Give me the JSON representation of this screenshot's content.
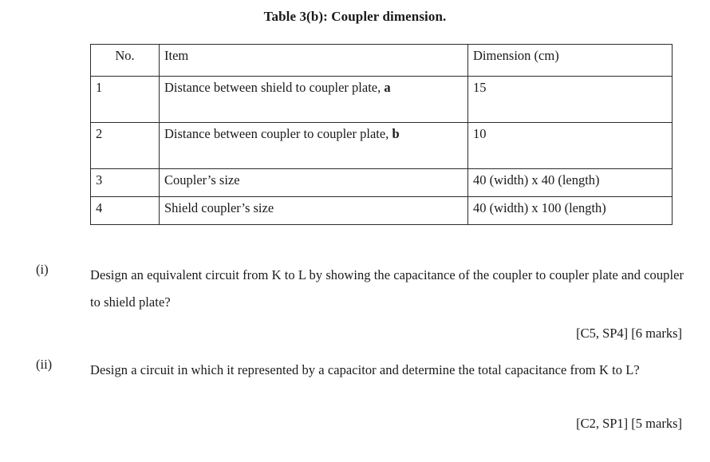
{
  "document": {
    "table_caption": "Table 3(b): Coupler dimension."
  },
  "table": {
    "headers": {
      "no": "No.",
      "item": "Item",
      "dimension": "Dimension (cm)"
    },
    "rows": [
      {
        "no": "1",
        "item_text": "Distance between shield to coupler plate, ",
        "item_bold": "a",
        "dimension": "15"
      },
      {
        "no": "2",
        "item_text": "Distance between coupler to coupler plate, ",
        "item_bold": "b",
        "dimension": "10"
      },
      {
        "no": "3",
        "item_text": "Coupler’s size",
        "item_bold": "",
        "dimension": "40  (width) x 40 (length)"
      },
      {
        "no": "4",
        "item_text": "Shield coupler’s size",
        "item_bold": "",
        "dimension": "40 (width) x 100 (length)"
      }
    ]
  },
  "questions": [
    {
      "label": "(i)",
      "text": "Design an equivalent circuit from K to L by showing the capacitance of the coupler to coupler plate and coupler to shield plate?",
      "marks": "[C5, SP4] [6 marks]"
    },
    {
      "label": "(ii)",
      "text": "Design a circuit in which it represented by a capacitor and determine the total capacitance from K to L?",
      "marks": "[C2, SP1] [5 marks]"
    }
  ]
}
